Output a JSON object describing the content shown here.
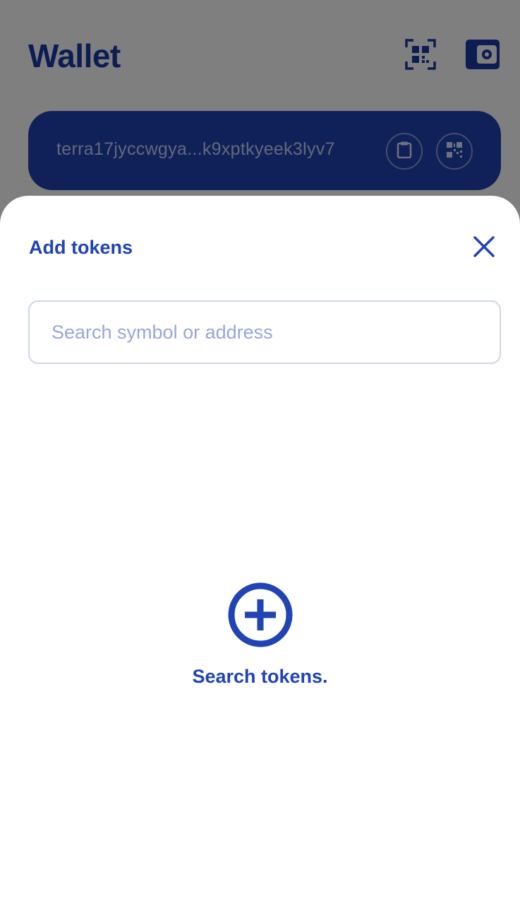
{
  "wallet": {
    "title": "Wallet",
    "address": "terra17jyccwgya...k9xptkyeek3lyv7"
  },
  "header_icons": [
    "qr-scan-icon",
    "wallet-settings-icon"
  ],
  "card_icons": [
    "clipboard-icon",
    "qr-code-icon"
  ],
  "sheet": {
    "title": "Add tokens",
    "close_icon": "close-icon",
    "search_placeholder": "Search symbol or address",
    "search_value": "",
    "empty_icon": "plus-circle-icon",
    "empty_text": "Search tokens."
  },
  "colors": {
    "brand": "#2043b5",
    "card": "#2043b5",
    "placeholder": "#98a6d6",
    "overlay": "rgba(0,0,0,0.5)"
  }
}
